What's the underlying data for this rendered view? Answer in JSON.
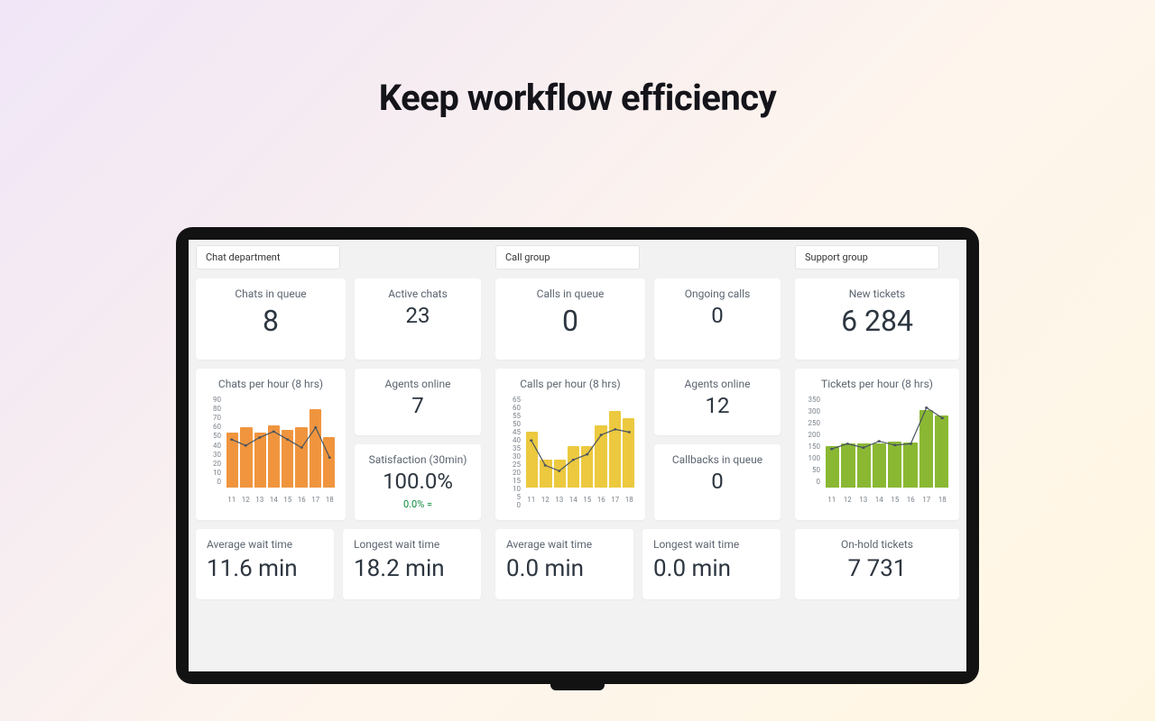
{
  "hero_title": "Keep workflow efficiency",
  "sections": {
    "chat": {
      "tab": "Chat department"
    },
    "call": {
      "tab": "Call group"
    },
    "support": {
      "tab": "Support group"
    }
  },
  "chat": {
    "chats_in_queue": {
      "title": "Chats in queue",
      "value": "8"
    },
    "active_chats": {
      "title": "Active chats",
      "value": "23"
    },
    "agents_online": {
      "title": "Agents online",
      "value": "7"
    },
    "satisfaction": {
      "title": "Satisfaction (30min)",
      "value": "100.0%",
      "change": "0.0% ="
    },
    "avg_wait": {
      "title": "Average wait time",
      "value": "11.6 min"
    },
    "longest_wait": {
      "title": "Longest wait time",
      "value": "18.2 min"
    }
  },
  "call": {
    "calls_in_queue": {
      "title": "Calls in queue",
      "value": "0"
    },
    "ongoing_calls": {
      "title": "Ongoing calls",
      "value": "0"
    },
    "agents_online": {
      "title": "Agents online",
      "value": "12"
    },
    "callbacks": {
      "title": "Callbacks in queue",
      "value": "0"
    },
    "avg_wait": {
      "title": "Average wait time",
      "value": "0.0 min"
    },
    "longest_wait": {
      "title": "Longest wait time",
      "value": "0.0 min"
    }
  },
  "support": {
    "new_tickets": {
      "title": "New tickets",
      "value": "6 284"
    },
    "on_hold": {
      "title": "On-hold tickets",
      "value": "7 731"
    }
  },
  "chart_data": [
    {
      "id": "chats_per_hour",
      "type": "bar+line",
      "title": "Chats per hour (8 hrs)",
      "categories": [
        "11",
        "12",
        "13",
        "14",
        "15",
        "16",
        "17",
        "18"
      ],
      "series": [
        {
          "name": "bars",
          "values": [
            55,
            60,
            55,
            62,
            58,
            60,
            78,
            50
          ]
        },
        {
          "name": "line",
          "values": [
            48,
            42,
            50,
            56,
            48,
            40,
            60,
            30
          ]
        }
      ],
      "ylim": [
        0,
        90
      ],
      "yticks": [
        0,
        10,
        20,
        30,
        40,
        50,
        60,
        70,
        80,
        90
      ],
      "bar_color": "orange"
    },
    {
      "id": "calls_per_hour",
      "type": "bar+line",
      "title": "Calls per hour (8 hrs)",
      "categories": [
        "11",
        "12",
        "13",
        "14",
        "15",
        "16",
        "17",
        "18"
      ],
      "series": [
        {
          "name": "bars",
          "values": [
            40,
            20,
            20,
            30,
            30,
            45,
            55,
            50
          ]
        },
        {
          "name": "line",
          "values": [
            34,
            16,
            12,
            20,
            24,
            38,
            42,
            40
          ]
        }
      ],
      "ylim": [
        0,
        65
      ],
      "yticks": [
        0,
        5,
        10,
        15,
        20,
        25,
        30,
        35,
        40,
        45,
        50,
        55,
        60,
        65
      ],
      "bar_color": "yellow"
    },
    {
      "id": "tickets_per_hour",
      "type": "bar+line",
      "title": "Tickets per hour (8 hrs)",
      "categories": [
        "11",
        "12",
        "13",
        "14",
        "15",
        "16",
        "17",
        "18"
      ],
      "series": [
        {
          "name": "bars",
          "values": [
            160,
            170,
            170,
            170,
            180,
            175,
            300,
            280
          ]
        },
        {
          "name": "line",
          "values": [
            150,
            170,
            155,
            180,
            165,
            170,
            310,
            270
          ]
        }
      ],
      "ylim": [
        0,
        350
      ],
      "yticks": [
        0,
        50,
        100,
        150,
        200,
        250,
        300,
        350
      ],
      "bar_color": "green"
    }
  ]
}
